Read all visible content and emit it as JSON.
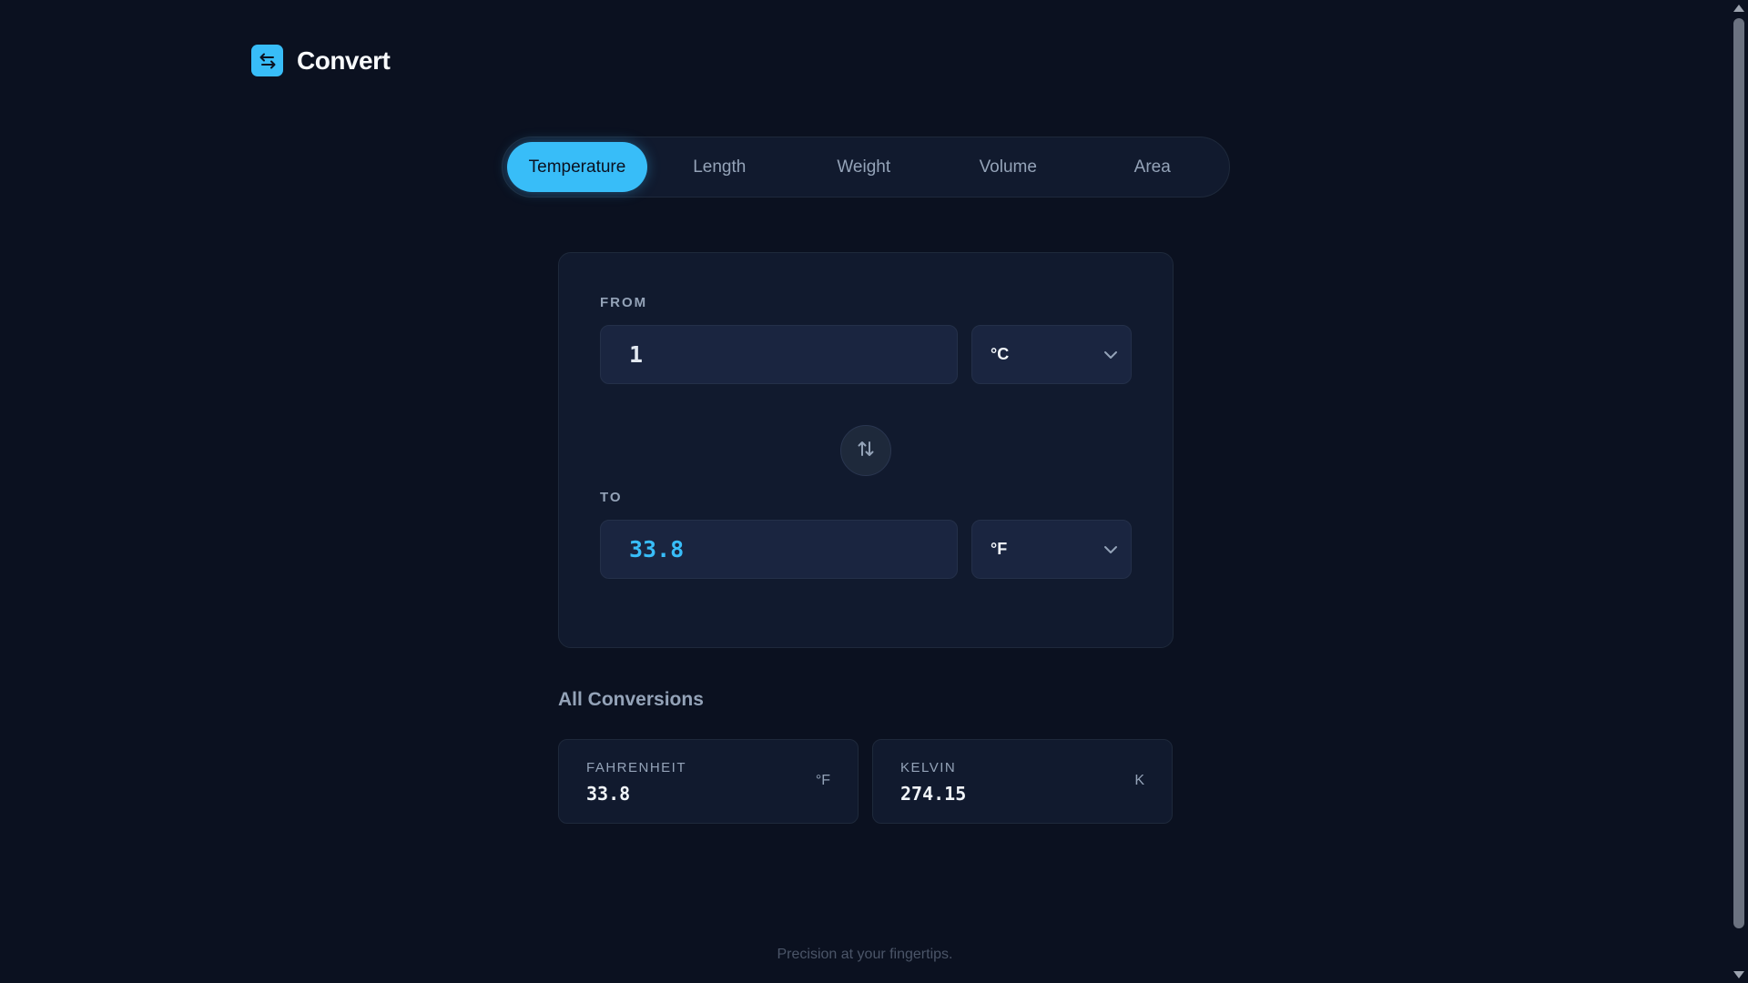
{
  "header": {
    "title": "Convert",
    "icon": "swap-arrows-icon"
  },
  "tabs": [
    {
      "label": "Temperature",
      "active": true
    },
    {
      "label": "Length",
      "active": false
    },
    {
      "label": "Weight",
      "active": false
    },
    {
      "label": "Volume",
      "active": false
    },
    {
      "label": "Area",
      "active": false
    }
  ],
  "converter": {
    "from": {
      "label": "FROM",
      "value": "1",
      "unit": "°C"
    },
    "to": {
      "label": "TO",
      "value": "33.8",
      "unit": "°F"
    },
    "swap_icon": "swap-vertical-icon"
  },
  "all_conversions": {
    "title": "All Conversions",
    "items": [
      {
        "name": "FAHRENHEIT",
        "value": "33.8",
        "unit": "°F"
      },
      {
        "name": "KELVIN",
        "value": "274.15",
        "unit": "K"
      }
    ]
  },
  "footer": {
    "text": "Precision at your fingertips."
  },
  "colors": {
    "accent": "#38bdf8",
    "background": "#0b1120",
    "card": "#111a2e"
  }
}
